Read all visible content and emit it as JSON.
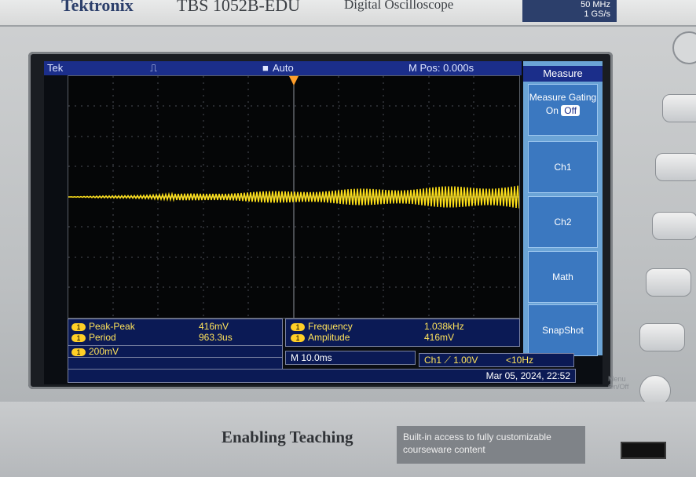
{
  "header": {
    "brand": "Tektronix",
    "model": "TBS 1052B-EDU",
    "product": "Digital Oscilloscope",
    "spec_line1": "50 MHz",
    "spec_line2": "1 GS/s"
  },
  "status_bar": {
    "brand_short": "Tek",
    "trigger_mode": "Auto",
    "m_pos": "M Pos: 0.000s"
  },
  "menu": {
    "title": "Measure",
    "gating_label": "Measure Gating",
    "gating_on": "On",
    "gating_off": "Off",
    "buttons": [
      "Ch1",
      "Ch2",
      "Math",
      "SnapShot"
    ]
  },
  "readouts": {
    "left": {
      "rows": [
        {
          "name": "Peak-Peak",
          "value": "416mV"
        },
        {
          "name": "Period",
          "value": "963.3us"
        }
      ]
    },
    "right": {
      "rows": [
        {
          "name": "Frequency",
          "value": "1.038kHz"
        },
        {
          "name": "Amplitude",
          "value": "416mV"
        }
      ]
    },
    "ch_scale": "200mV",
    "timebase": "M 10.0ms",
    "trigger": "Ch1 ⟋ 1.00V",
    "freq_limit": "<10Hz",
    "datetime": "Mar 05, 2024, 22:52"
  },
  "front_panel": {
    "enabling": "Enabling Teaching",
    "builtin_line1": "Built-in access to fully customizable",
    "builtin_line2": "courseware content",
    "menu_onoff_line1": "Menu",
    "menu_onoff_line2": "On/Off"
  },
  "colors": {
    "trace": "#ffe11a",
    "screen_blue": "#1b2e8a",
    "menu_blue": "#6ba4d6"
  }
}
